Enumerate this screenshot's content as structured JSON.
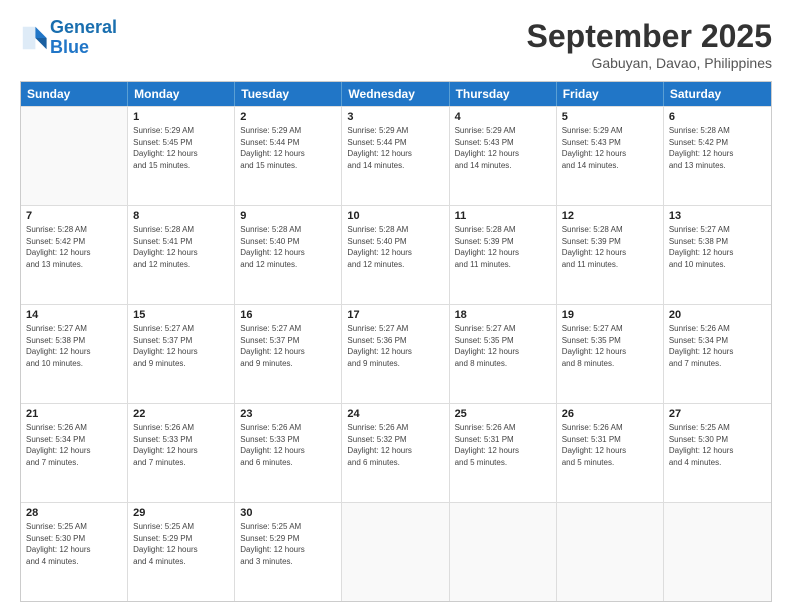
{
  "logo": {
    "line1": "General",
    "line2": "Blue"
  },
  "title": "September 2025",
  "location": "Gabuyan, Davao, Philippines",
  "header_days": [
    "Sunday",
    "Monday",
    "Tuesday",
    "Wednesday",
    "Thursday",
    "Friday",
    "Saturday"
  ],
  "weeks": [
    [
      {
        "day": "",
        "info": ""
      },
      {
        "day": "1",
        "info": "Sunrise: 5:29 AM\nSunset: 5:45 PM\nDaylight: 12 hours\nand 15 minutes."
      },
      {
        "day": "2",
        "info": "Sunrise: 5:29 AM\nSunset: 5:44 PM\nDaylight: 12 hours\nand 15 minutes."
      },
      {
        "day": "3",
        "info": "Sunrise: 5:29 AM\nSunset: 5:44 PM\nDaylight: 12 hours\nand 14 minutes."
      },
      {
        "day": "4",
        "info": "Sunrise: 5:29 AM\nSunset: 5:43 PM\nDaylight: 12 hours\nand 14 minutes."
      },
      {
        "day": "5",
        "info": "Sunrise: 5:29 AM\nSunset: 5:43 PM\nDaylight: 12 hours\nand 14 minutes."
      },
      {
        "day": "6",
        "info": "Sunrise: 5:28 AM\nSunset: 5:42 PM\nDaylight: 12 hours\nand 13 minutes."
      }
    ],
    [
      {
        "day": "7",
        "info": "Sunrise: 5:28 AM\nSunset: 5:42 PM\nDaylight: 12 hours\nand 13 minutes."
      },
      {
        "day": "8",
        "info": "Sunrise: 5:28 AM\nSunset: 5:41 PM\nDaylight: 12 hours\nand 12 minutes."
      },
      {
        "day": "9",
        "info": "Sunrise: 5:28 AM\nSunset: 5:40 PM\nDaylight: 12 hours\nand 12 minutes."
      },
      {
        "day": "10",
        "info": "Sunrise: 5:28 AM\nSunset: 5:40 PM\nDaylight: 12 hours\nand 12 minutes."
      },
      {
        "day": "11",
        "info": "Sunrise: 5:28 AM\nSunset: 5:39 PM\nDaylight: 12 hours\nand 11 minutes."
      },
      {
        "day": "12",
        "info": "Sunrise: 5:28 AM\nSunset: 5:39 PM\nDaylight: 12 hours\nand 11 minutes."
      },
      {
        "day": "13",
        "info": "Sunrise: 5:27 AM\nSunset: 5:38 PM\nDaylight: 12 hours\nand 10 minutes."
      }
    ],
    [
      {
        "day": "14",
        "info": "Sunrise: 5:27 AM\nSunset: 5:38 PM\nDaylight: 12 hours\nand 10 minutes."
      },
      {
        "day": "15",
        "info": "Sunrise: 5:27 AM\nSunset: 5:37 PM\nDaylight: 12 hours\nand 9 minutes."
      },
      {
        "day": "16",
        "info": "Sunrise: 5:27 AM\nSunset: 5:37 PM\nDaylight: 12 hours\nand 9 minutes."
      },
      {
        "day": "17",
        "info": "Sunrise: 5:27 AM\nSunset: 5:36 PM\nDaylight: 12 hours\nand 9 minutes."
      },
      {
        "day": "18",
        "info": "Sunrise: 5:27 AM\nSunset: 5:35 PM\nDaylight: 12 hours\nand 8 minutes."
      },
      {
        "day": "19",
        "info": "Sunrise: 5:27 AM\nSunset: 5:35 PM\nDaylight: 12 hours\nand 8 minutes."
      },
      {
        "day": "20",
        "info": "Sunrise: 5:26 AM\nSunset: 5:34 PM\nDaylight: 12 hours\nand 7 minutes."
      }
    ],
    [
      {
        "day": "21",
        "info": "Sunrise: 5:26 AM\nSunset: 5:34 PM\nDaylight: 12 hours\nand 7 minutes."
      },
      {
        "day": "22",
        "info": "Sunrise: 5:26 AM\nSunset: 5:33 PM\nDaylight: 12 hours\nand 7 minutes."
      },
      {
        "day": "23",
        "info": "Sunrise: 5:26 AM\nSunset: 5:33 PM\nDaylight: 12 hours\nand 6 minutes."
      },
      {
        "day": "24",
        "info": "Sunrise: 5:26 AM\nSunset: 5:32 PM\nDaylight: 12 hours\nand 6 minutes."
      },
      {
        "day": "25",
        "info": "Sunrise: 5:26 AM\nSunset: 5:31 PM\nDaylight: 12 hours\nand 5 minutes."
      },
      {
        "day": "26",
        "info": "Sunrise: 5:26 AM\nSunset: 5:31 PM\nDaylight: 12 hours\nand 5 minutes."
      },
      {
        "day": "27",
        "info": "Sunrise: 5:25 AM\nSunset: 5:30 PM\nDaylight: 12 hours\nand 4 minutes."
      }
    ],
    [
      {
        "day": "28",
        "info": "Sunrise: 5:25 AM\nSunset: 5:30 PM\nDaylight: 12 hours\nand 4 minutes."
      },
      {
        "day": "29",
        "info": "Sunrise: 5:25 AM\nSunset: 5:29 PM\nDaylight: 12 hours\nand 4 minutes."
      },
      {
        "day": "30",
        "info": "Sunrise: 5:25 AM\nSunset: 5:29 PM\nDaylight: 12 hours\nand 3 minutes."
      },
      {
        "day": "",
        "info": ""
      },
      {
        "day": "",
        "info": ""
      },
      {
        "day": "",
        "info": ""
      },
      {
        "day": "",
        "info": ""
      }
    ]
  ]
}
